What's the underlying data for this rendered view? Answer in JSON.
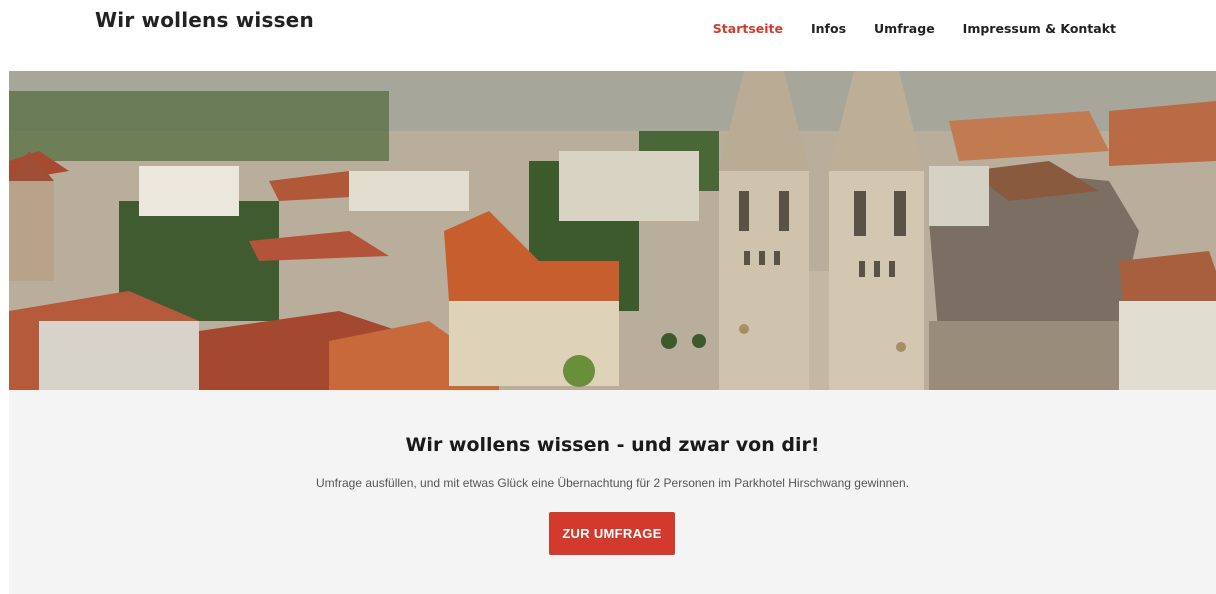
{
  "header": {
    "site_title": "Wir wollens wissen",
    "nav": [
      {
        "label": "Startseite",
        "active": true
      },
      {
        "label": "Infos",
        "active": false
      },
      {
        "label": "Umfrage",
        "active": false
      },
      {
        "label": "Impressum & Kontakt",
        "active": false
      }
    ]
  },
  "hero": {
    "image": "aerial-city-photo"
  },
  "cta": {
    "headline": "Wir wollens wissen - und zwar von dir!",
    "text": "Umfrage ausfüllen, und mit etwas Glück eine Übernachtung für 2 Personen im Parkhotel Hirschwang gewinnen.",
    "button_label": "ZUR UMFRAGE"
  },
  "colors": {
    "accent": "#d93a2f",
    "button": "#d13a2c",
    "cta_background": "#f4f4f4"
  }
}
